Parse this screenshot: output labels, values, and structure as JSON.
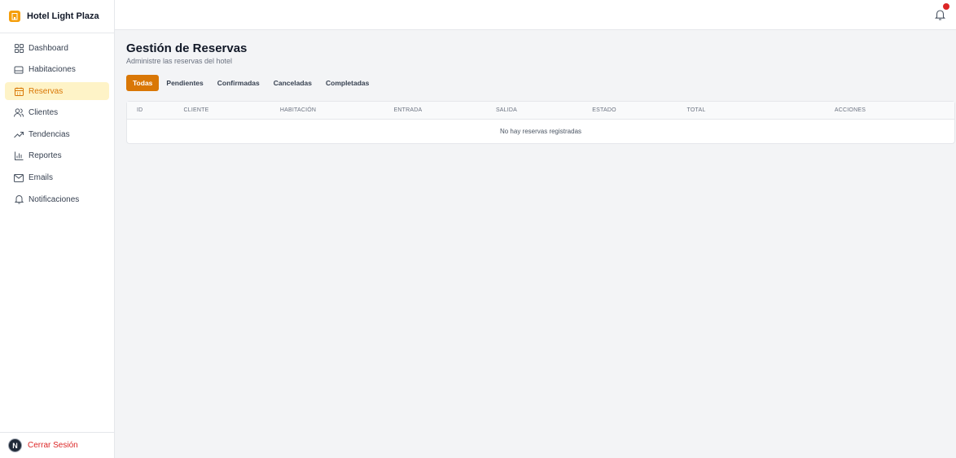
{
  "brand": {
    "name": "Hotel Light Plaza",
    "icon": "hotel-icon",
    "accent": "#f59e0b"
  },
  "sidebar": {
    "items": [
      {
        "label": "Dashboard",
        "icon": "grid-icon"
      },
      {
        "label": "Habitaciones",
        "icon": "bed-icon"
      },
      {
        "label": "Reservas",
        "icon": "calendar-icon",
        "active": true
      },
      {
        "label": "Clientes",
        "icon": "users-icon"
      },
      {
        "label": "Tendencias",
        "icon": "trend-icon"
      },
      {
        "label": "Reportes",
        "icon": "bar-chart-icon"
      },
      {
        "label": "Emails",
        "icon": "mail-icon"
      },
      {
        "label": "Notificaciones",
        "icon": "bell-icon"
      }
    ],
    "logout_label": "Cerrar Sesión",
    "avatar_letter": "N"
  },
  "topbar": {
    "notification_icon": "bell-icon",
    "notification_dot_color": "#dc2626"
  },
  "main": {
    "title": "Gestión de Reservas",
    "subtitle": "Administre las reservas del hotel",
    "tabs": [
      "Todas",
      "Pendientes",
      "Confirmadas",
      "Canceladas",
      "Completadas"
    ],
    "active_tab": "Todas",
    "table": {
      "columns": [
        "ID",
        "CLIENTE",
        "HABITACIÓN",
        "ENTRADA",
        "SALIDA",
        "ESTADO",
        "TOTAL",
        "ACCIONES"
      ],
      "empty_message": "No hay reservas registradas"
    }
  }
}
